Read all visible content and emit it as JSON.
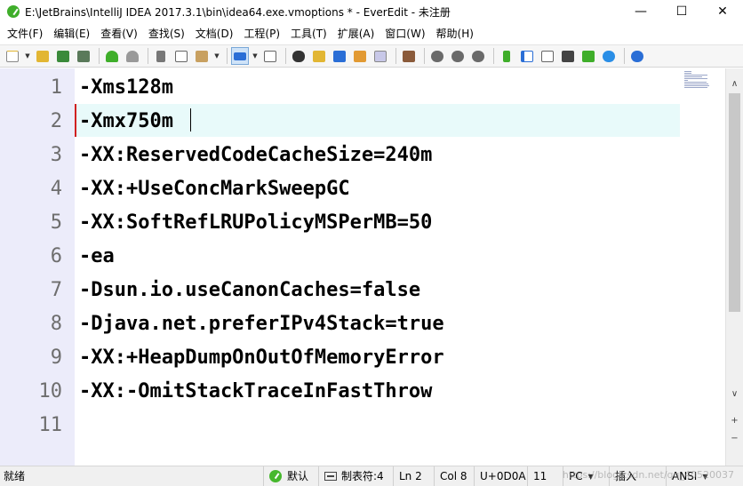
{
  "window": {
    "title": "E:\\JetBrains\\IntelliJ IDEA 2017.3.1\\bin\\idea64.exe.vmoptions * - EverEdit - 未注册",
    "minimize": "—",
    "maximize": "☐",
    "close": "✕"
  },
  "menu": [
    "文件(F)",
    "编辑(E)",
    "查看(V)",
    "查找(S)",
    "文档(D)",
    "工程(P)",
    "工具(T)",
    "扩展(A)",
    "窗口(W)",
    "帮助(H)"
  ],
  "toolbar": {
    "icons": [
      "new-file-icon",
      "open-file-icon",
      "save-icon",
      "save-all-icon",
      "undo-icon",
      "redo-icon",
      "cut-icon",
      "copy-icon",
      "paste-icon",
      "word-wrap-icon",
      "column-icon",
      "find-icon",
      "find-in-files-icon",
      "replace-icon",
      "find-next-icon",
      "goto-icon",
      "macro-icon",
      "tool-1-icon",
      "tool-2-icon",
      "tool-3-icon",
      "tree-icon",
      "sidebar-left-icon",
      "sidebar-right-icon",
      "output-icon",
      "console-icon",
      "browser-icon",
      "help-icon"
    ],
    "colors": {
      "accent": "#2a6ed6",
      "green": "#3fae2a",
      "yellow": "#e2b633"
    }
  },
  "editor": {
    "current_line": 2,
    "lines": [
      "-Xms128m",
      "-Xmx750m",
      "-XX:ReservedCodeCacheSize=240m",
      "-XX:+UseConcMarkSweepGC",
      "-XX:SoftRefLRUPolicyMSPerMB=50",
      "-ea",
      "-Dsun.io.useCanonCaches=false",
      "-Djava.net.preferIPv4Stack=true",
      "-XX:+HeapDumpOnOutOfMemoryError",
      "-XX:-OmitStackTraceInFastThrow",
      ""
    ],
    "line_numbers": [
      "1",
      "2",
      "3",
      "4",
      "5",
      "6",
      "7",
      "8",
      "9",
      "10",
      "11"
    ]
  },
  "scrollbar": {
    "up": "▲",
    "down": "▼",
    "plus": "+",
    "minus": "−",
    "collapse": "∧",
    "expand": "∨"
  },
  "status": {
    "ready": "就绪",
    "syntax": "默认",
    "tab": "制表符:4",
    "line": "Ln 2",
    "col": "Col 8",
    "char": "U+0D0A",
    "size": "11",
    "eol": "PC",
    "mode": "插入",
    "encoding": "ANSI",
    "watermark": "https://blog.csdn.net/qq_40520037"
  }
}
